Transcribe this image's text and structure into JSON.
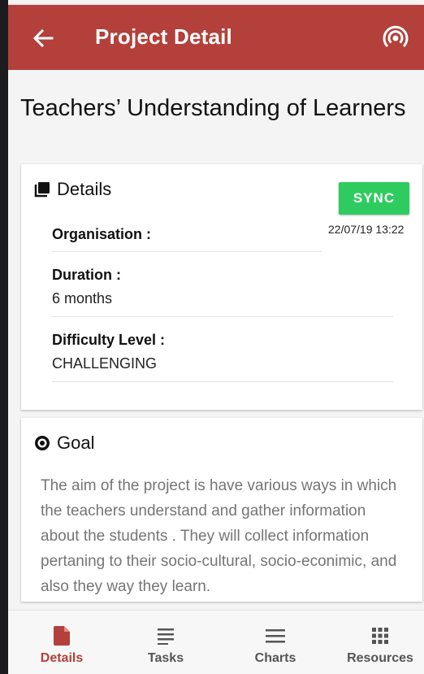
{
  "colors": {
    "primary": "#b3403a",
    "sync": "#2ecc5f",
    "muted_text": "#757575"
  },
  "appbar": {
    "title": "Project Detail",
    "back_icon": "arrow-left-icon",
    "action_icon": "podcast-icon"
  },
  "project": {
    "title": "Teachers’ Understanding of Learners"
  },
  "details": {
    "header": "Details",
    "header_icon": "stack-icon",
    "sync_label": "SYNC",
    "timestamp": "22/07/19 13:22",
    "fields": [
      {
        "label": "Organisation :",
        "value": ""
      },
      {
        "label": "Duration :",
        "value": "6 months"
      },
      {
        "label": "Difficulty Level :",
        "value": "CHALLENGING"
      }
    ]
  },
  "goal": {
    "header": "Goal",
    "header_icon": "radio-button-icon",
    "text": "The aim of the project is have various ways in which the teachers understand and gather information about the students . They will collect information pertaning to their socio-cultural, socio-econimic, and also they way they learn."
  },
  "bottom_nav": {
    "active": "Details",
    "items": [
      {
        "label": "Details",
        "icon": "document-icon"
      },
      {
        "label": "Tasks",
        "icon": "notes-icon"
      },
      {
        "label": "Charts",
        "icon": "menu-icon"
      },
      {
        "label": "Resources",
        "icon": "grid-icon"
      }
    ]
  }
}
